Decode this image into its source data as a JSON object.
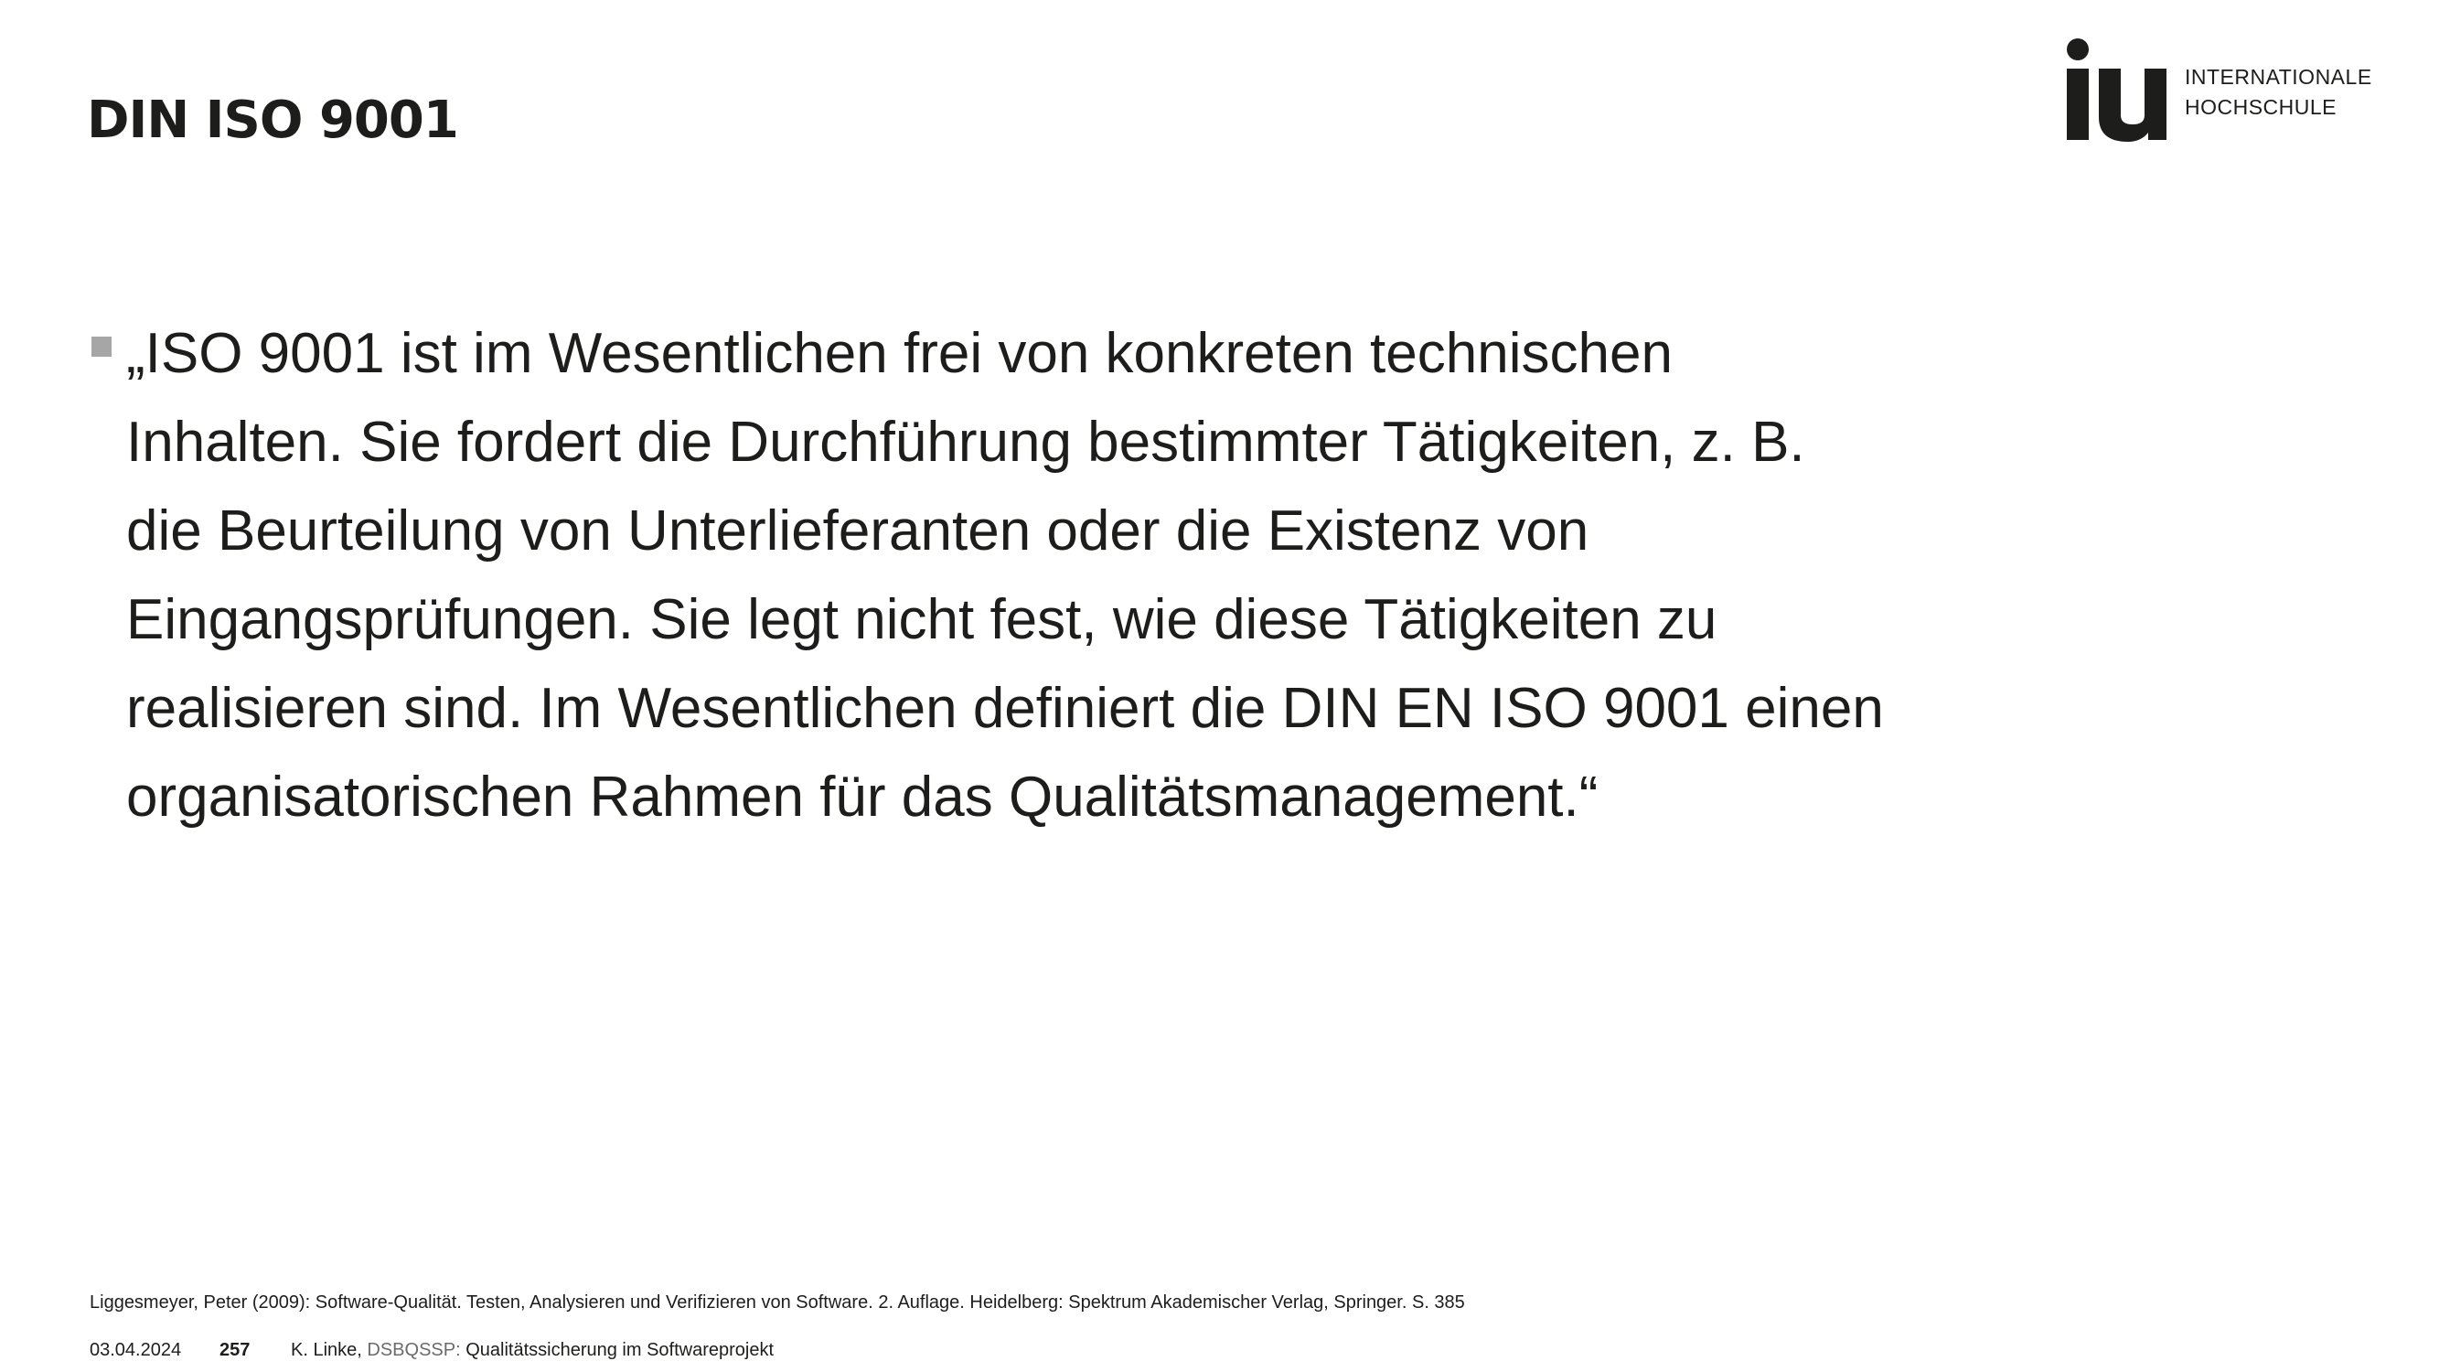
{
  "slide": {
    "title": "DIN ISO 9001"
  },
  "logo": {
    "mark": "iu",
    "line1": "INTERNATIONALE",
    "line2": "HOCHSCHULE"
  },
  "content": {
    "bullet_lines": [
      "„ISO 9001 ist im Wesentlichen frei von konkreten technischen",
      "Inhalten. Sie fordert die Durchführung bestimmter Tätigkeiten, z. B.",
      "die Beurteilung von Unterlieferanten oder die Existenz von",
      "Eingangsprüfungen. Sie legt nicht fest, wie diese Tätigkeiten zu",
      "realisieren sind. Im Wesentlichen definiert die DIN EN ISO 9001 einen",
      "organisatorischen Rahmen für das Qualitätsmanagement.“"
    ]
  },
  "footnote": {
    "text": "Liggesmeyer, Peter (2009): Software-Qualität. Testen, Analysieren und Verifizieren von Software. 2. Auflage. Heidelberg: Spektrum Akademischer Verlag, Springer. S. 385"
  },
  "footer": {
    "date": "03.04.2024",
    "page_number": "257",
    "author": "K. Linke,",
    "course_code": "DSBQSSP:",
    "course_title": "Qualitätssicherung im Softwareprojekt"
  }
}
